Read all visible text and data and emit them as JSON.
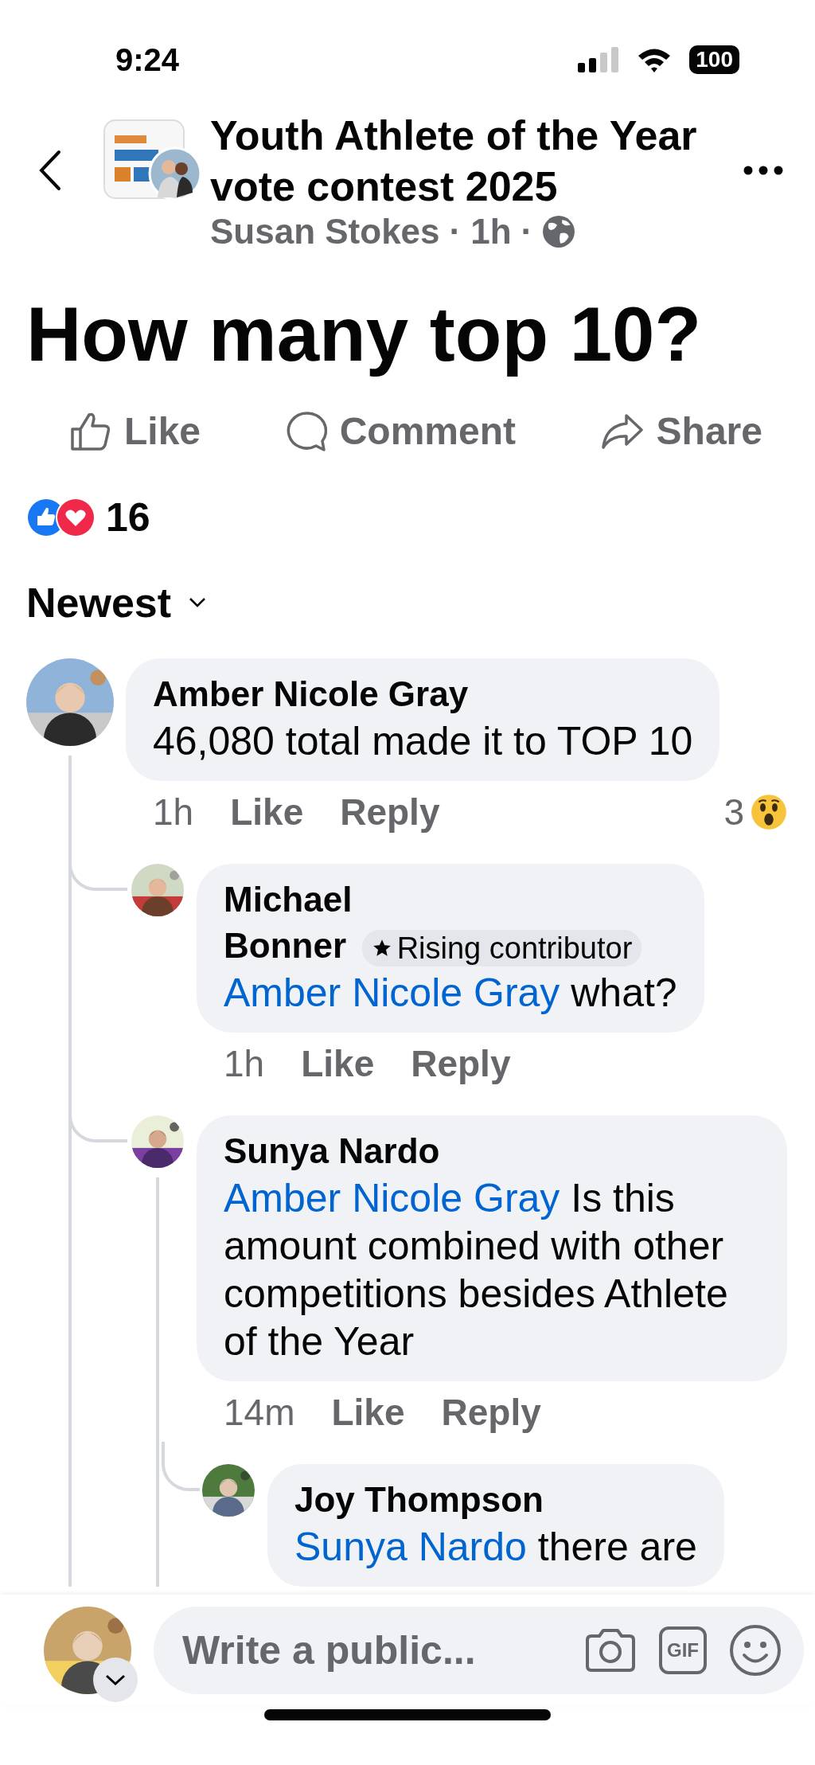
{
  "status_bar": {
    "time": "9:24",
    "battery": "100"
  },
  "header": {
    "title": "Youth Athlete of the Year vote contest 2025",
    "author": "Susan Stokes",
    "time": "1h",
    "separator": "·"
  },
  "post": {
    "text": "How many top 10?"
  },
  "actions": [
    {
      "kind": "like",
      "label": "Like"
    },
    {
      "kind": "comment",
      "label": "Comment"
    },
    {
      "kind": "share",
      "label": "Share"
    }
  ],
  "reactions": {
    "count": "16"
  },
  "sort": {
    "label": "Newest"
  },
  "comments": [
    {
      "author": "Amber Nicole Gray",
      "text": "46,080 total made it to TOP 10",
      "time": "1h",
      "actions": [
        "Like",
        "Reply"
      ],
      "reaction_count": "3",
      "children": [
        {
          "author": "Michael Bonner",
          "badge": "Rising contributor",
          "mention": "Amber Nicole Gray",
          "text": "what?",
          "time": "1h",
          "actions": [
            "Like",
            "Reply"
          ]
        },
        {
          "author": "Sunya Nardo",
          "mention": "Amber Nicole Gray",
          "text": "Is this amount combined with other competitions besides Athlete  of the Year",
          "time": "14m",
          "actions": [
            "Like",
            "Reply"
          ],
          "children": [
            {
              "author": "Joy Thompson",
              "mention": "Sunya Nardo",
              "text": "there are"
            }
          ]
        }
      ]
    }
  ],
  "composer": {
    "placeholder": "Write a public...",
    "gif_label": "GIF"
  }
}
